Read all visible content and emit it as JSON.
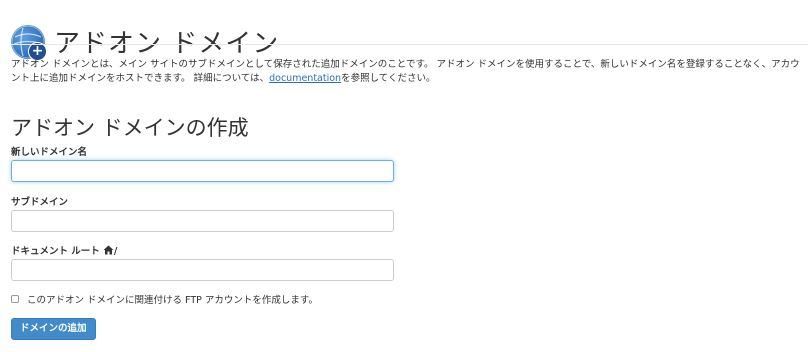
{
  "header": {
    "title": "アドオン ドメイン",
    "icon": "globe-add-icon"
  },
  "description": {
    "text_before_link": "アドオン ドメインとは、メイン サイトのサブドメインとして保存された追加ドメインのことです。 アドオン ドメインを使用することで、新しいドメイン名を登録することなく、アカウント上に追加ドメインをホストできます。 詳細については、",
    "link_text": "documentation",
    "text_after_link": "を参照してください。"
  },
  "form": {
    "section_title": "アドオン ドメインの作成",
    "new_domain_label": "新しいドメイン名",
    "new_domain_value": "",
    "subdomain_label": "サブドメイン",
    "subdomain_value": "",
    "document_root_label": "ドキュメント ルート",
    "document_root_suffix": "/",
    "document_root_icon": "home-icon",
    "document_root_value": "",
    "ftp_checkbox_label": "このアドオン ドメインに関連付ける FTP アカウントを作成します。",
    "ftp_checkbox_checked": false,
    "submit_label": "ドメインの追加"
  },
  "colors": {
    "accent": "#428bca",
    "link": "#2a6fbb",
    "text": "#333333"
  }
}
